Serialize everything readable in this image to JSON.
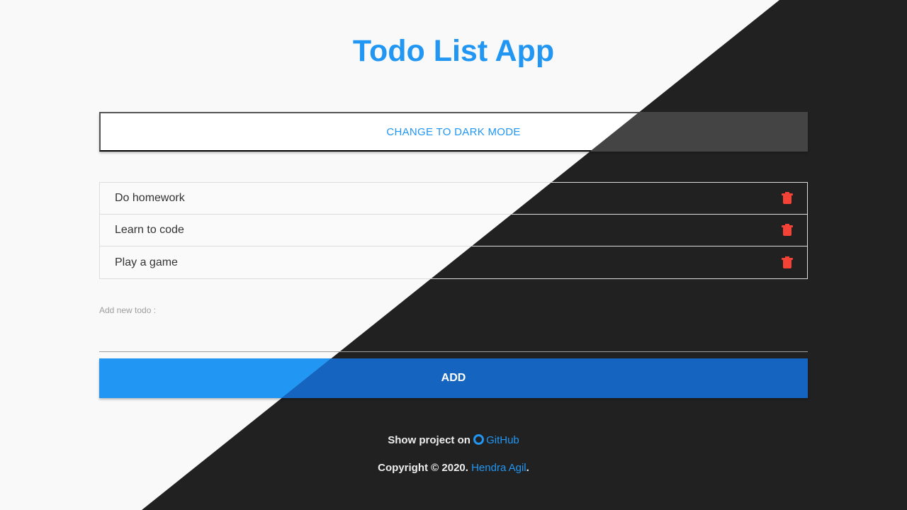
{
  "title": "Todo List App",
  "mode_button": "CHANGE TO DARK MODE",
  "todos": [
    {
      "text": "Do homework"
    },
    {
      "text": "Learn to code"
    },
    {
      "text": "Play a game"
    }
  ],
  "input": {
    "label": "Add new todo :",
    "value": ""
  },
  "add_button": "ADD",
  "footer": {
    "show_text": "Show project on",
    "github_link": "GitHub",
    "copyright": "Copyright © 2020.",
    "author_link": "Hendra Agil",
    "period": "."
  },
  "colors": {
    "accent": "#2196f3",
    "delete": "#f44336",
    "dark_bg": "#212121"
  }
}
